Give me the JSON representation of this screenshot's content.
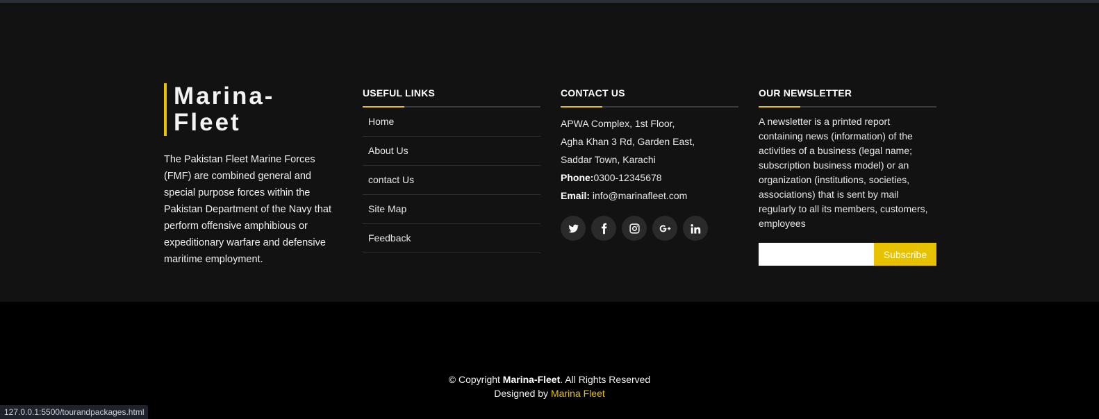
{
  "about": {
    "logo": "Marina-Fleet",
    "description": "The Pakistan Fleet Marine Forces (FMF) are combined general and special purpose forces within the Pakistan Department of the Navy that perform offensive amphibious or expeditionary warfare and defensive maritime employment."
  },
  "links": {
    "title": "USEFUL LINKS",
    "items": [
      {
        "label": "Home"
      },
      {
        "label": "About Us"
      },
      {
        "label": "contact Us"
      },
      {
        "label": "Site Map"
      },
      {
        "label": "Feedback"
      }
    ]
  },
  "contact": {
    "title": "CONTACT US",
    "address_line1": "APWA Complex, 1st Floor,",
    "address_line2": "Agha Khan 3 Rd, Garden East,",
    "address_line3": "Saddar Town, Karachi",
    "phone_label": "Phone:",
    "phone": "0300-12345678",
    "email_label": "Email:",
    "email": "info@marinafleet.com",
    "social": [
      "twitter-icon",
      "facebook-icon",
      "instagram-icon",
      "google-plus-icon",
      "linkedin-icon"
    ]
  },
  "newsletter": {
    "title": "OUR NEWSLETTER",
    "text": "A newsletter is a printed report containing news (information) of the activities of a business (legal name; subscription business model) or an organization (institutions, societies, associations) that is sent by mail regularly to all its members, customers, employees",
    "input_value": "",
    "button_label": "Subscribe"
  },
  "copyright": {
    "prefix": "© Copyright ",
    "brand": "Marina-Fleet",
    "suffix": ". All Rights Reserved",
    "designed_by": "Designed by ",
    "designer": "Marina Fleet"
  },
  "status_url": "127.0.0.1:5500/tourandpackages.html",
  "colors": {
    "accent": "#e6c200",
    "footer_top": "#121212",
    "footer_bottom": "#000000"
  }
}
